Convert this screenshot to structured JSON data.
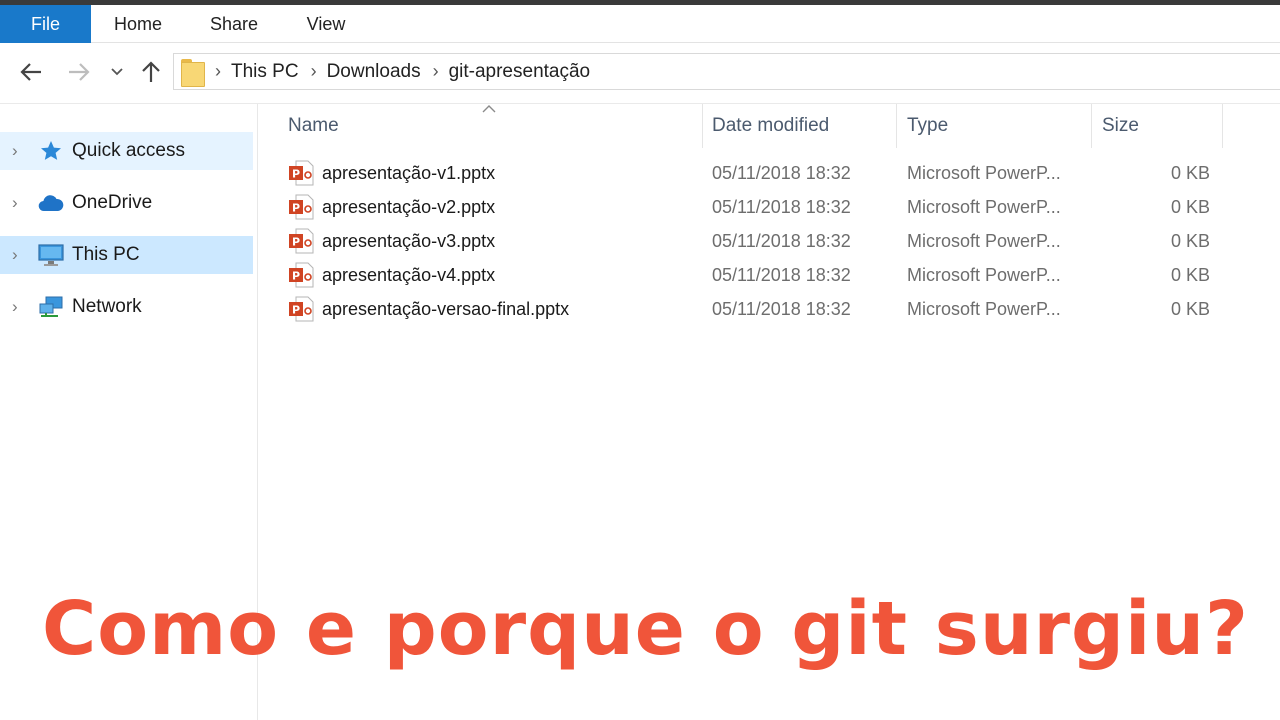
{
  "ribbon": {
    "tabs": [
      "File",
      "Home",
      "Share",
      "View"
    ]
  },
  "nav": {
    "back_icon": "arrow-left-icon",
    "forward_icon": "arrow-right-icon",
    "recent_icon": "chevron-down-icon",
    "up_icon": "arrow-up-icon",
    "breadcrumb": [
      "This PC",
      "Downloads",
      "git-apresentação"
    ]
  },
  "sidebar": {
    "items": [
      {
        "label": "Quick access",
        "icon": "star-icon"
      },
      {
        "label": "OneDrive",
        "icon": "cloud-icon"
      },
      {
        "label": "This PC",
        "icon": "computer-icon"
      },
      {
        "label": "Network",
        "icon": "network-icon"
      }
    ],
    "selected": "This PC"
  },
  "columns": {
    "name": "Name",
    "date": "Date modified",
    "type": "Type",
    "size": "Size"
  },
  "files": [
    {
      "name": "apresentação-v1.pptx",
      "date": "05/11/2018 18:32",
      "type": "Microsoft PowerP...",
      "size": "0 KB"
    },
    {
      "name": "apresentação-v2.pptx",
      "date": "05/11/2018 18:32",
      "type": "Microsoft PowerP...",
      "size": "0 KB"
    },
    {
      "name": "apresentação-v3.pptx",
      "date": "05/11/2018 18:32",
      "type": "Microsoft PowerP...",
      "size": "0 KB"
    },
    {
      "name": "apresentação-v4.pptx",
      "date": "05/11/2018 18:32",
      "type": "Microsoft PowerP...",
      "size": "0 KB"
    },
    {
      "name": "apresentação-versao-final.pptx",
      "date": "05/11/2018 18:32",
      "type": "Microsoft PowerP...",
      "size": "0 KB"
    }
  ],
  "caption": "Como e porque o git surgiu?",
  "colors": {
    "file_tab": "#1979ca",
    "selection": "#cce8ff",
    "caption": "#f0553a",
    "powerpoint": "#d04423"
  }
}
